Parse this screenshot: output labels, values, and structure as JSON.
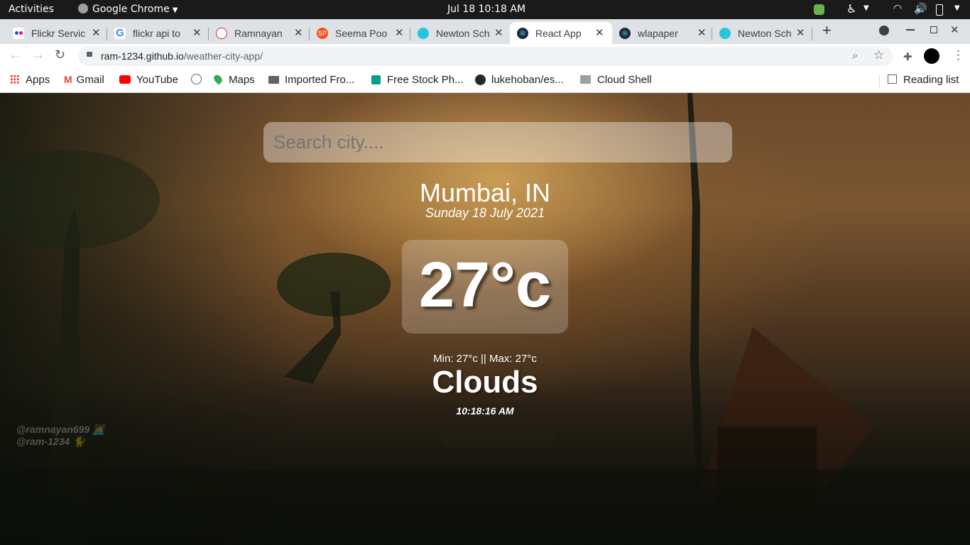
{
  "os": {
    "activities": "Activities",
    "app_name": "Google Chrome",
    "clock": "Jul 18  10:18 AM"
  },
  "tabs": [
    {
      "title": "Flickr Servic",
      "favicon": "flickr-icon",
      "color": "#ff0084"
    },
    {
      "title": "flickr api to",
      "favicon": "google-icon",
      "color": "#4285f4"
    },
    {
      "title": "Ramnayan",
      "favicon": "portfolio-icon",
      "color": "#c0392b"
    },
    {
      "title": "Seema Poo",
      "favicon": "sp-icon",
      "color": "#f4511e"
    },
    {
      "title": "Newton Sch",
      "favicon": "newton-icon",
      "color": "#26c6da"
    },
    {
      "title": "React App",
      "favicon": "react-icon",
      "color": "#1a2a3a"
    },
    {
      "title": "wlapaper",
      "favicon": "react-icon",
      "color": "#1a2a3a"
    },
    {
      "title": "Newton Sch",
      "favicon": "newton-icon",
      "color": "#26c6da"
    }
  ],
  "address_bar": {
    "host": "ram-1234.github.io",
    "path": "/weather-city-app/"
  },
  "bookmarks": [
    {
      "label": "Apps",
      "icon": "apps-grid-icon"
    },
    {
      "label": "Gmail",
      "icon": "gmail-icon"
    },
    {
      "label": "YouTube",
      "icon": "youtube-icon"
    },
    {
      "label": "",
      "icon": "globe-icon"
    },
    {
      "label": "Maps",
      "icon": "maps-icon"
    },
    {
      "label": "Imported Fro...",
      "icon": "folder-icon"
    },
    {
      "label": "Free Stock Ph...",
      "icon": "stock-photo-icon"
    },
    {
      "label": "lukehoban/es...",
      "icon": "github-icon"
    },
    {
      "label": "Cloud Shell",
      "icon": "cloud-shell-icon"
    }
  ],
  "reading_list": "Reading list",
  "weather": {
    "search_placeholder": "Search city....",
    "city": "Mumbai, IN",
    "date": "Sunday 18 July 2021",
    "temperature": "27°c",
    "min_max": "Min: 27°c || Max: 27°c",
    "condition": "Clouds",
    "time": "10:18:16 AM"
  },
  "watermark": {
    "line1": "@ramnayan699 🧑‍💻",
    "line2": "@ram-1234 🐈"
  },
  "colors": {
    "tab_strip": "#dee1e6",
    "active_tab": "#ffffff",
    "os_bar": "#1a1a1a"
  }
}
